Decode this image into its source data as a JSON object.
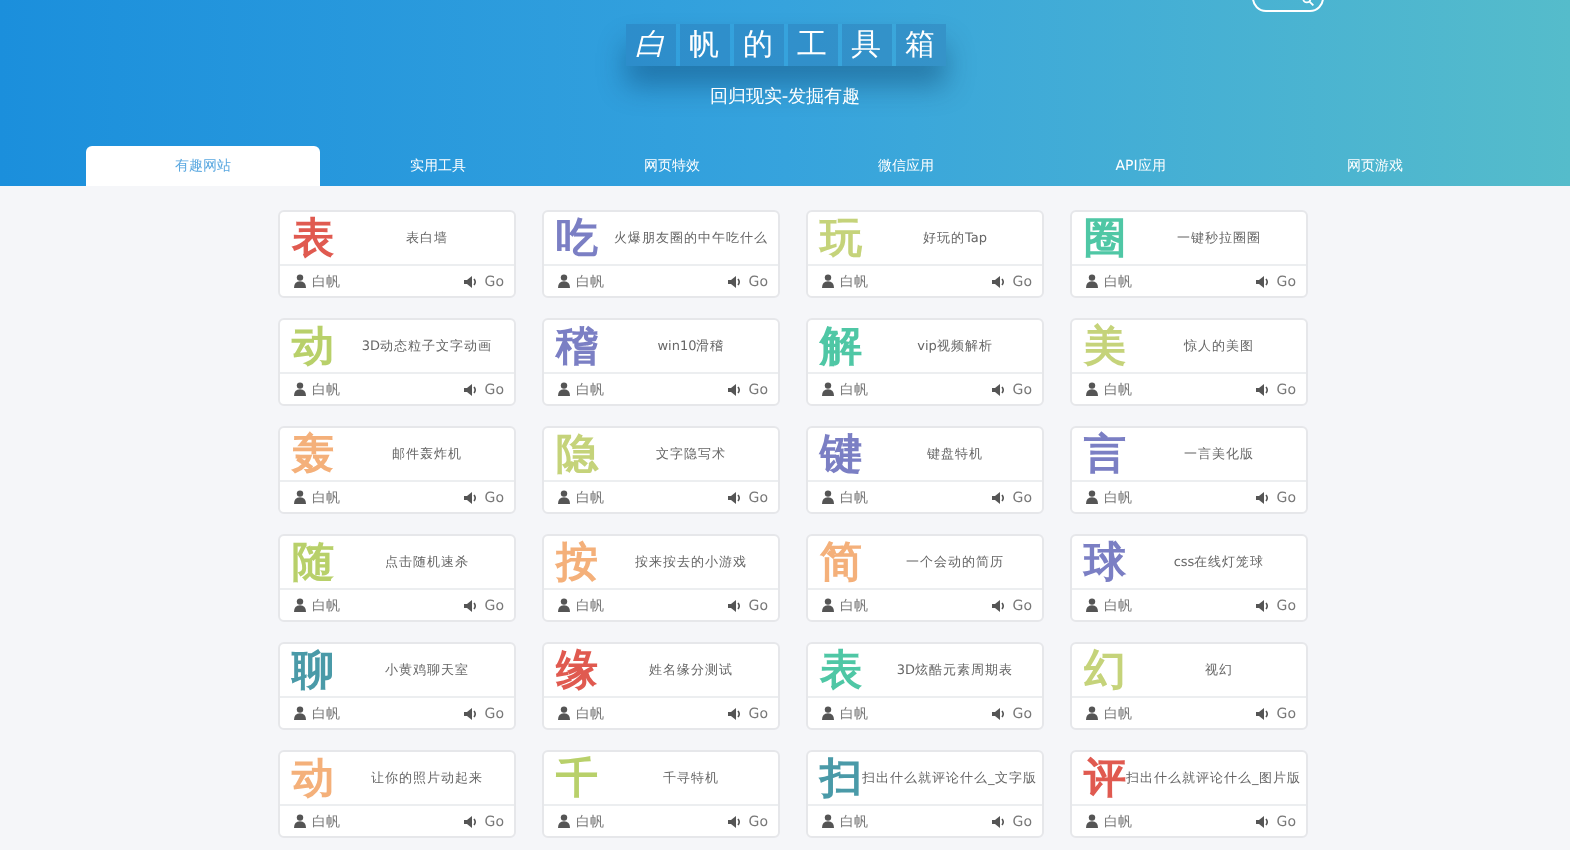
{
  "header": {
    "title_chars": [
      "白",
      "帆",
      "的",
      "工",
      "具",
      "箱"
    ],
    "subtitle": "回归现实-发掘有趣"
  },
  "tabs": [
    {
      "label": "有趣网站",
      "selected": true
    },
    {
      "label": "实用工具",
      "selected": false
    },
    {
      "label": "网页特效",
      "selected": false
    },
    {
      "label": "微信应用",
      "selected": false
    },
    {
      "label": "API应用",
      "selected": false
    },
    {
      "label": "网页游戏",
      "selected": false
    }
  ],
  "cards": [
    {
      "char": "表",
      "color": "#e05a50",
      "desc": "表白墙",
      "author": "白帆",
      "action": "Go"
    },
    {
      "char": "吃",
      "color": "#7b7fc4",
      "desc": "火爆朋友圈的中午吃什么",
      "author": "白帆",
      "action": "Go"
    },
    {
      "char": "玩",
      "color": "#c5d37a",
      "desc": "好玩的Tap",
      "author": "白帆",
      "action": "Go"
    },
    {
      "char": "圈",
      "color": "#4fc7a5",
      "desc": "一键秒拉圈圈",
      "author": "白帆",
      "action": "Go"
    },
    {
      "char": "动",
      "color": "#b8d06a",
      "desc": "3D动态粒子文字动画",
      "author": "白帆",
      "action": "Go"
    },
    {
      "char": "稽",
      "color": "#7b7fc4",
      "desc": "win10滑稽",
      "author": "白帆",
      "action": "Go"
    },
    {
      "char": "解",
      "color": "#4fc7a5",
      "desc": "vip视频解析",
      "author": "白帆",
      "action": "Go"
    },
    {
      "char": "美",
      "color": "#c5d37a",
      "desc": "惊人的美图",
      "author": "白帆",
      "action": "Go"
    },
    {
      "char": "轰",
      "color": "#f4b07a",
      "desc": "邮件轰炸机",
      "author": "白帆",
      "action": "Go"
    },
    {
      "char": "隐",
      "color": "#c5d37a",
      "desc": "文字隐写术",
      "author": "白帆",
      "action": "Go"
    },
    {
      "char": "键",
      "color": "#7b7fc4",
      "desc": "键盘特机",
      "author": "白帆",
      "action": "Go"
    },
    {
      "char": "言",
      "color": "#7b7fc4",
      "desc": "一言美化版",
      "author": "白帆",
      "action": "Go"
    },
    {
      "char": "随",
      "color": "#b8d06a",
      "desc": "点击随机速杀",
      "author": "白帆",
      "action": "Go"
    },
    {
      "char": "按",
      "color": "#f4b07a",
      "desc": "按来按去的小游戏",
      "author": "白帆",
      "action": "Go"
    },
    {
      "char": "简",
      "color": "#f4b07a",
      "desc": "一个会动的简历",
      "author": "白帆",
      "action": "Go"
    },
    {
      "char": "球",
      "color": "#7b7fc4",
      "desc": "css在线灯笼球",
      "author": "白帆",
      "action": "Go"
    },
    {
      "char": "聊",
      "color": "#4a9aa8",
      "desc": "小黄鸡聊天室",
      "author": "白帆",
      "action": "Go"
    },
    {
      "char": "缘",
      "color": "#e05a50",
      "desc": "姓名缘分测试",
      "author": "白帆",
      "action": "Go"
    },
    {
      "char": "表",
      "color": "#4fc7a5",
      "desc": "3D炫酷元素周期表",
      "author": "白帆",
      "action": "Go"
    },
    {
      "char": "幻",
      "color": "#c5d37a",
      "desc": "视幻",
      "author": "白帆",
      "action": "Go"
    },
    {
      "char": "动",
      "color": "#f4b07a",
      "desc": "让你的照片动起来",
      "author": "白帆",
      "action": "Go"
    },
    {
      "char": "千",
      "color": "#b8d06a",
      "desc": "千寻特机",
      "author": "白帆",
      "action": "Go"
    },
    {
      "char": "扫",
      "color": "#4a9aa8",
      "desc": "扫出什么就评论什么_文字版",
      "author": "白帆",
      "action": "Go"
    },
    {
      "char": "评",
      "color": "#e05a50",
      "desc": "扫出什么就评论什么_图片版",
      "author": "白帆",
      "action": "Go"
    }
  ]
}
